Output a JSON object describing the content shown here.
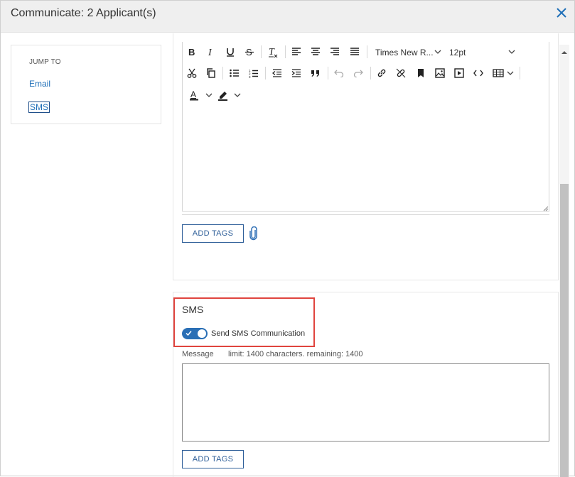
{
  "dialog": {
    "title": "Communicate: 2 Applicant(s)",
    "close_icon": "close-icon"
  },
  "jump": {
    "heading": "JUMP TO",
    "links": [
      "Email",
      "SMS"
    ]
  },
  "editor": {
    "font_family": "Times New R...",
    "font_size": "12pt",
    "toolbar_icons": [
      "bold-icon",
      "italic-icon",
      "underline-icon",
      "strikethrough-icon",
      "clear-format-icon",
      "align-left-icon",
      "align-center-icon",
      "align-right-icon",
      "align-justify-icon",
      "cut-icon",
      "copy-icon",
      "bullet-list-icon",
      "numbered-list-icon",
      "outdent-icon",
      "indent-icon",
      "blockquote-icon",
      "undo-icon",
      "redo-icon",
      "link-icon",
      "unlink-icon",
      "bookmark-icon",
      "image-icon",
      "video-icon",
      "code-icon",
      "table-icon",
      "font-color-icon",
      "highlight-icon"
    ],
    "add_tags_label": "ADD TAGS"
  },
  "sms": {
    "title": "SMS",
    "toggle_label": "Send SMS Communication",
    "toggle_on": true,
    "message_label": "Message",
    "limit_text": "limit: 1400 characters. remaining: 1400",
    "message_value": "",
    "add_tags_label": "ADD TAGS"
  },
  "colors": {
    "accent": "#2a6fb5",
    "highlight_border": "#e0443e",
    "link": "#1f6fb8"
  }
}
